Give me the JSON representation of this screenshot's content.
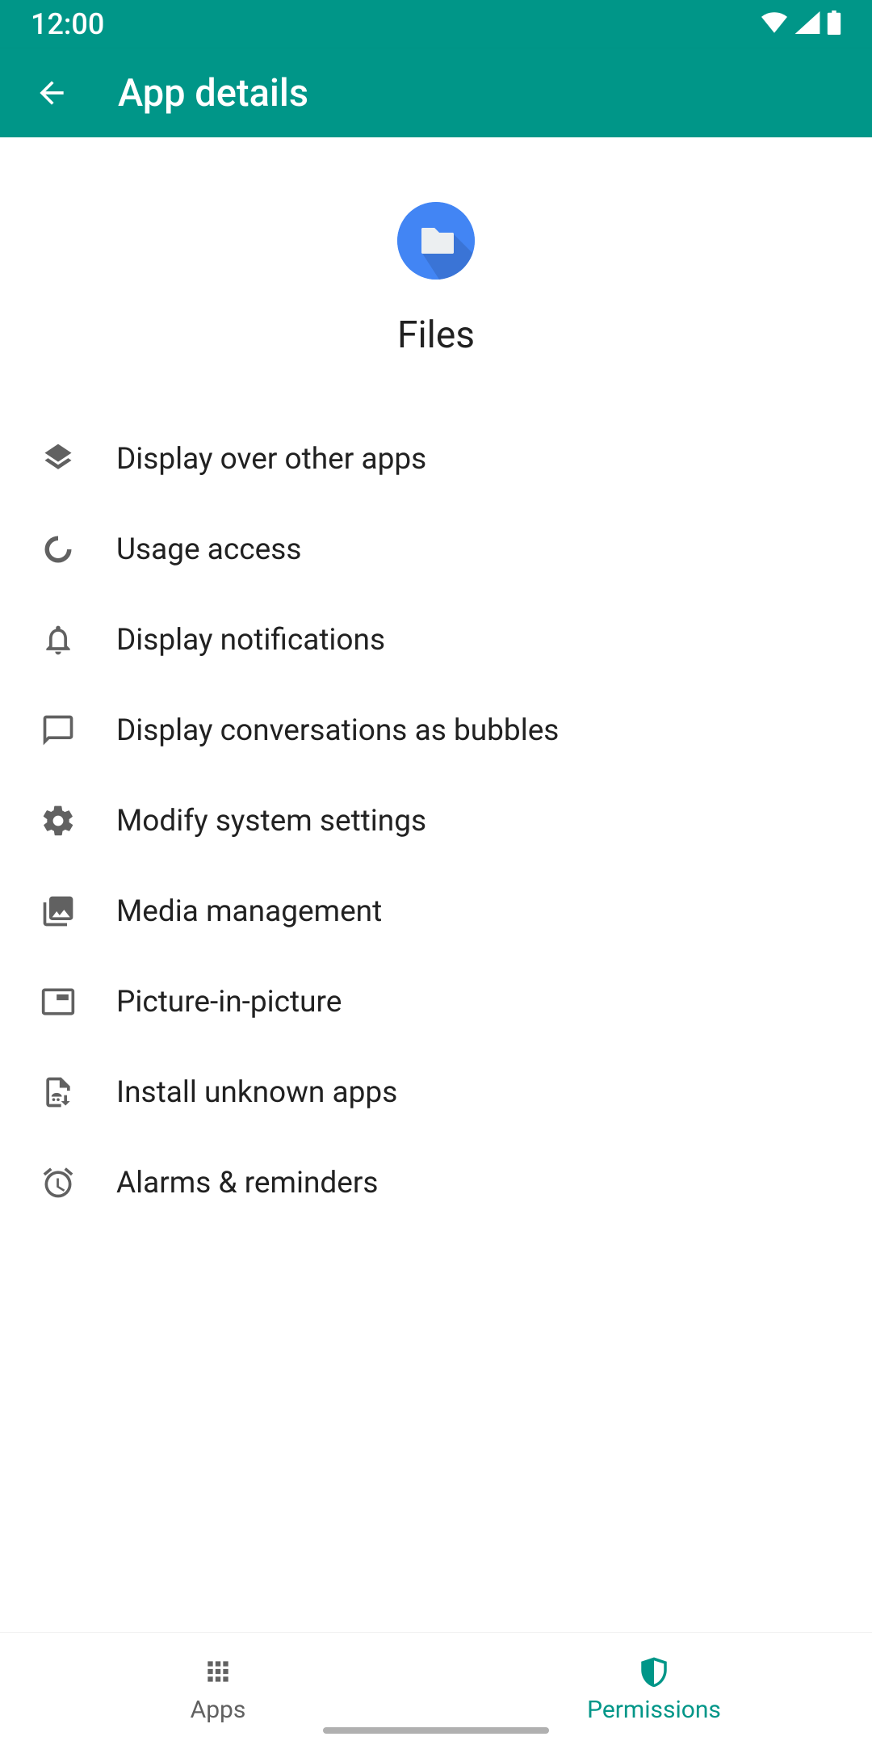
{
  "status": {
    "time": "12:00"
  },
  "header": {
    "title": "App details"
  },
  "app": {
    "name": "Files",
    "icon_bg": "#4285F4"
  },
  "permissions": [
    {
      "key": "display-over-apps",
      "icon": "layers-icon",
      "label": "Display over other apps"
    },
    {
      "key": "usage-access",
      "icon": "usage-icon",
      "label": "Usage access"
    },
    {
      "key": "display-notifications",
      "icon": "bell-icon",
      "label": "Display notifications"
    },
    {
      "key": "display-conversations-bubbles",
      "icon": "chat-icon",
      "label": "Display conversations as bubbles"
    },
    {
      "key": "modify-system-settings",
      "icon": "gear-icon",
      "label": "Modify system settings"
    },
    {
      "key": "media-management",
      "icon": "media-icon",
      "label": "Media management"
    },
    {
      "key": "picture-in-picture",
      "icon": "pip-icon",
      "label": "Picture-in-picture"
    },
    {
      "key": "install-unknown-apps",
      "icon": "install-icon",
      "label": "Install unknown apps"
    },
    {
      "key": "alarms-reminders",
      "icon": "alarm-icon",
      "label": "Alarms & reminders"
    }
  ],
  "nav": {
    "apps": "Apps",
    "permissions": "Permissions",
    "active": "permissions"
  },
  "colors": {
    "primary": "#009688",
    "icon_gray": "#616161"
  }
}
